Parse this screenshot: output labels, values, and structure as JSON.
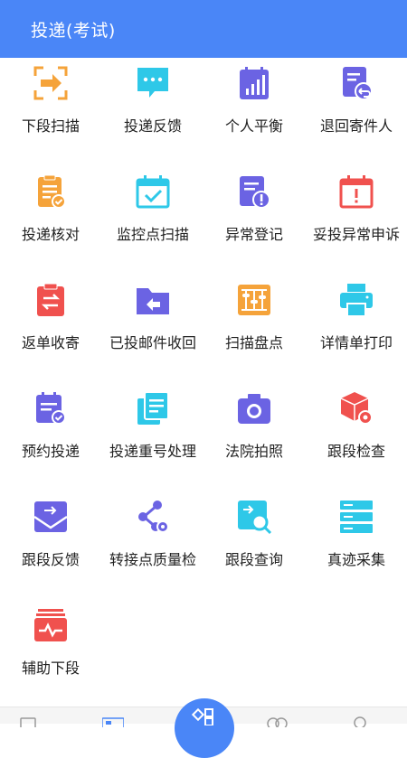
{
  "header": {
    "title": "投递(考试)"
  },
  "menu": {
    "items": [
      {
        "label": "下段扫描",
        "icon": "scan-arrow-icon"
      },
      {
        "label": "投递反馈",
        "icon": "chat-bubble-icon"
      },
      {
        "label": "个人平衡",
        "icon": "balance-chart-icon"
      },
      {
        "label": "退回寄件人",
        "icon": "return-document-icon"
      },
      {
        "label": "投递核对",
        "icon": "clipboard-check-icon"
      },
      {
        "label": "监控点扫描",
        "icon": "calendar-check-icon"
      },
      {
        "label": "异常登记",
        "icon": "warning-document-icon"
      },
      {
        "label": "妥投异常申诉",
        "icon": "calendar-alert-icon"
      },
      {
        "label": "返单收寄",
        "icon": "exchange-clipboard-icon"
      },
      {
        "label": "已投邮件收回",
        "icon": "folder-return-icon"
      },
      {
        "label": "扫描盘点",
        "icon": "abacus-icon"
      },
      {
        "label": "详情单打印",
        "icon": "printer-icon"
      },
      {
        "label": "预约投递",
        "icon": "appointment-calendar-icon"
      },
      {
        "label": "投递重号处理",
        "icon": "duplicate-documents-icon"
      },
      {
        "label": "法院拍照",
        "icon": "camera-icon"
      },
      {
        "label": "跟段检查",
        "icon": "package-gear-icon"
      },
      {
        "label": "跟段反馈",
        "icon": "inbox-envelope-icon"
      },
      {
        "label": "转接点质量检",
        "icon": "share-nodes-gear-icon"
      },
      {
        "label": "跟段查询",
        "icon": "search-document-icon"
      },
      {
        "label": "真迹采集",
        "icon": "server-list-icon"
      },
      {
        "label": "辅助下段",
        "icon": "pulse-inbox-icon"
      }
    ]
  },
  "tabbar": {
    "tabs": [
      "home-tab-icon",
      "apps-tab-icon",
      "messages-tab-icon",
      "profile-tab-icon"
    ],
    "center": "center-action-icon"
  },
  "colors": {
    "header": "#4a86f7",
    "orange": "#f5a33a",
    "cyan": "#2ec8e8",
    "purple": "#6b63e3",
    "red": "#f0514e"
  }
}
